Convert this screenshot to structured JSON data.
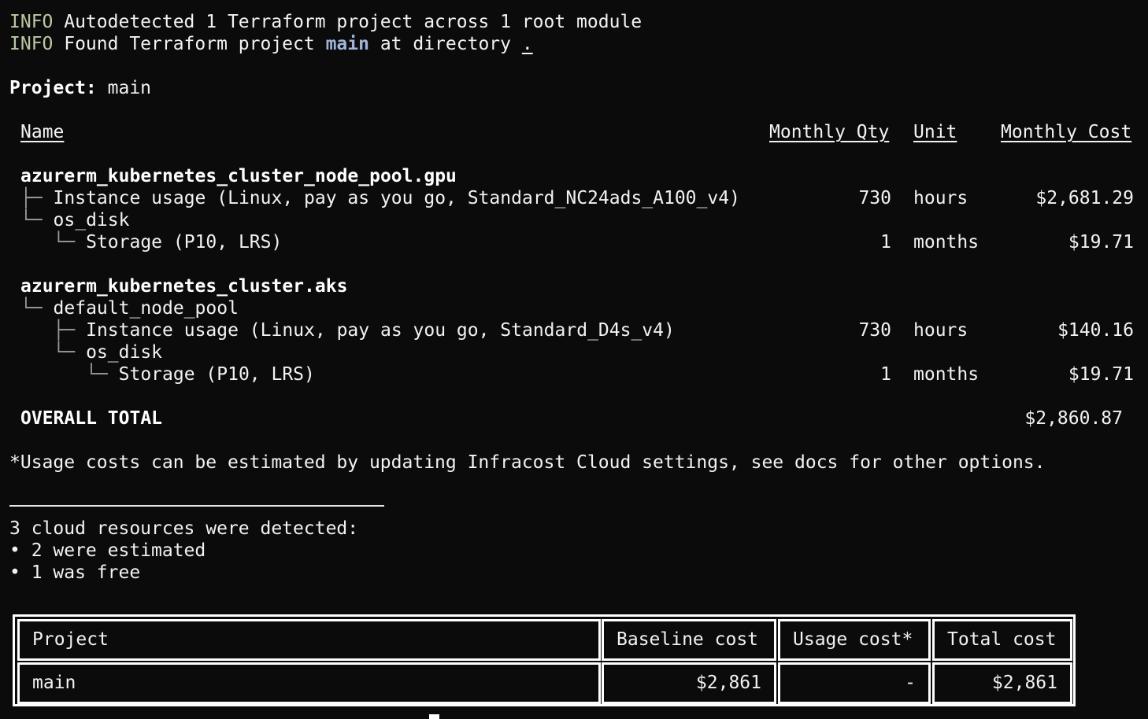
{
  "log": [
    {
      "level": "INFO",
      "text": " Autodetected 1 Terraform project across 1 root module"
    },
    {
      "level": "INFO",
      "prefix": " Found Terraform project ",
      "project": "main",
      "middle": " at directory ",
      "dir": "."
    }
  ],
  "project_header": {
    "label": "Project:",
    "value": " main"
  },
  "columns": {
    "name": "Name",
    "qty": "Monthly Qty",
    "unit": "Unit",
    "cost": "Monthly Cost"
  },
  "resources": [
    {
      "name": "azurerm_kubernetes_cluster_node_pool.gpu",
      "rows": [
        {
          "tree": "├─ ",
          "label": "Instance usage (Linux, pay as you go, Standard_NC24ads_A100_v4)",
          "qty": "730",
          "unit": "hours",
          "cost": "$2,681.29"
        },
        {
          "tree": "└─ ",
          "label": "os_disk",
          "qty": "",
          "unit": "",
          "cost": ""
        },
        {
          "tree": "   └─ ",
          "label": "Storage (P10, LRS)",
          "qty": "1",
          "unit": "months",
          "cost": "$19.71"
        }
      ]
    },
    {
      "name": "azurerm_kubernetes_cluster.aks",
      "rows": [
        {
          "tree": "└─ ",
          "label": "default_node_pool",
          "qty": "",
          "unit": "",
          "cost": ""
        },
        {
          "tree": "   ├─ ",
          "label": "Instance usage (Linux, pay as you go, Standard_D4s_v4)",
          "qty": "730",
          "unit": "hours",
          "cost": "$140.16"
        },
        {
          "tree": "   └─ ",
          "label": "os_disk",
          "qty": "",
          "unit": "",
          "cost": ""
        },
        {
          "tree": "      └─ ",
          "label": "Storage (P10, LRS)",
          "qty": "1",
          "unit": "months",
          "cost": "$19.71"
        }
      ]
    }
  ],
  "overall": {
    "label": "OVERALL TOTAL",
    "value": "$2,860.87"
  },
  "note": "*Usage costs can be estimated by updating Infracost Cloud settings, see docs for other options.",
  "summary": {
    "headline": "3 cloud resources were detected:",
    "items": [
      "• 2 were estimated",
      "• 1 was free"
    ]
  },
  "table": {
    "headers": {
      "project": "Project",
      "baseline": "Baseline cost",
      "usage": "Usage cost*",
      "total": "Total cost"
    },
    "row": {
      "project": "main",
      "baseline": "$2,861",
      "usage": "-",
      "total": "$2,861"
    }
  }
}
